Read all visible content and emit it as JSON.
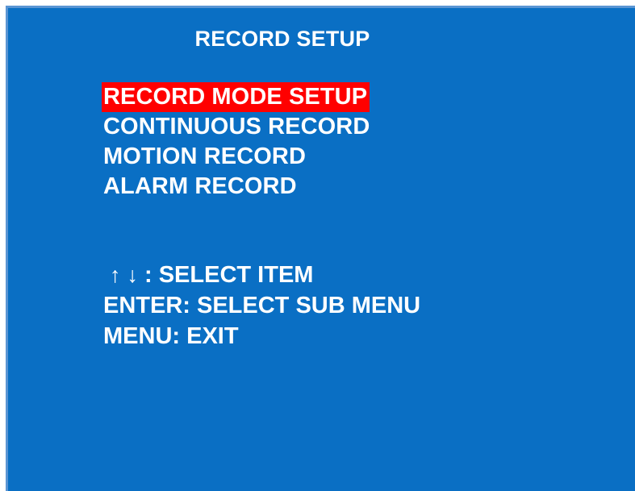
{
  "screen": {
    "title": "RECORD SETUP",
    "background_color": "#0a6fc4",
    "highlight_color": "#ff0000"
  },
  "menu": {
    "items": [
      {
        "label": "RECORD MODE SETUP",
        "selected": true
      },
      {
        "label": "CONTINUOUS RECORD",
        "selected": false
      },
      {
        "label": "MOTION RECORD",
        "selected": false
      },
      {
        "label": "ALARM RECORD",
        "selected": false
      }
    ]
  },
  "help": {
    "up_arrow": "↑",
    "down_arrow": "↓",
    "select_item": ": SELECT ITEM",
    "enter_line": "ENTER: SELECT SUB MENU",
    "menu_line": "MENU: EXIT"
  }
}
